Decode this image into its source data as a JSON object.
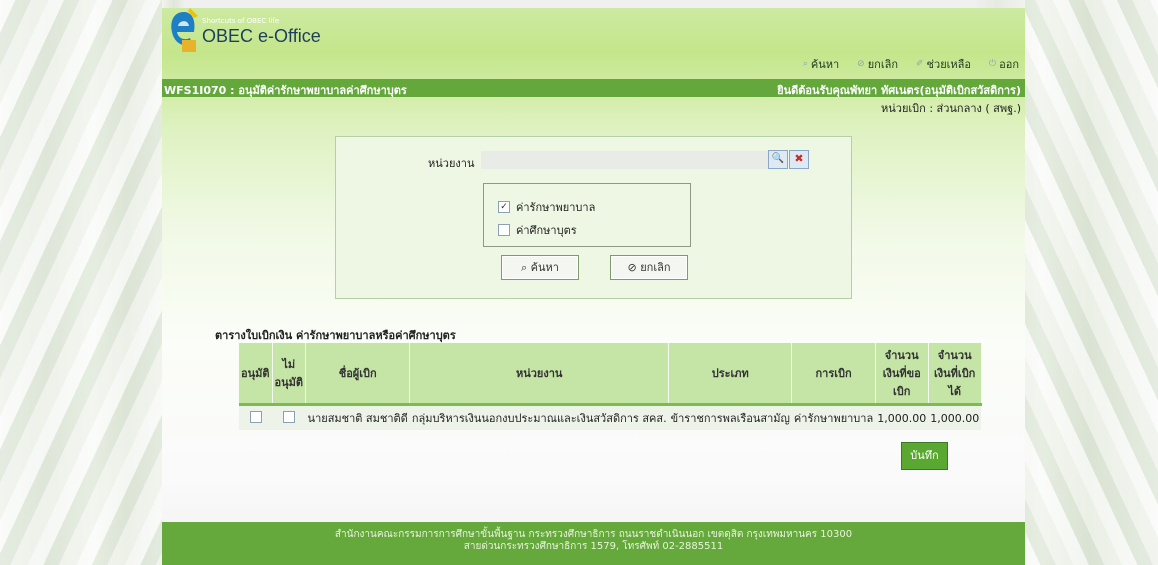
{
  "header": {
    "tagline": "Shortcuts of OBEC life",
    "app_title": "OBEC e-Office",
    "nav": [
      {
        "label": "ค้นหา",
        "icon": "search-icon"
      },
      {
        "label": "ยกเลิก",
        "icon": "cancel-icon"
      },
      {
        "label": "ช่วยเหลือ",
        "icon": "help-icon"
      },
      {
        "label": "ออก",
        "icon": "logout-icon"
      }
    ]
  },
  "titlebar": {
    "page_title": "WFS1I070 : อนุมัติค่ารักษาพยาบาลค่าศึกษาบุตร",
    "welcome": "ยินดีต้อนรับคุณพัทยา ทัศเนตร(อนุมัติเบิกสวัสดิการ)"
  },
  "unit_info": "หน่วยเบิก : ส่วนกลาง ( สพฐ.)",
  "search": {
    "unit_label": "หน่วยงาน",
    "unit_value": "",
    "options": [
      {
        "label": "ค่ารักษาพยาบาล",
        "checked": true
      },
      {
        "label": "ค่าศึกษาบุตร",
        "checked": false
      }
    ],
    "search_button": "ค้นหา",
    "cancel_button": "ยกเลิก"
  },
  "table": {
    "title": "ตารางใบเบิกเงิน ค่ารักษาพยาบาลหรือค่าศึกษาบุตร",
    "headers": [
      "อนุมัติ",
      "ไม่อนุมัติ",
      "ชื่อผู้เบิก",
      "หน่วยงาน",
      "ประเภท",
      "การเบิก",
      "จำนวนเงินที่ขอเบิก",
      "จำนวนเงินที่เบิกได้"
    ],
    "rows": [
      {
        "approve": false,
        "reject": false,
        "name": "นายสมชาติ สมชาติดี",
        "unit": "กลุ่มบริหารเงินนอกงบประมาณและเงินสวัสดิการ สคส.",
        "type": "ข้าราชการพลเรือนสามัญ",
        "claim": "ค่ารักษาพยาบาล",
        "requested": "1,000.00",
        "approved": "1,000.00"
      }
    ],
    "save_button": "บันทึก"
  },
  "footer": {
    "line1": "สำนักงานคณะกรรมการการศึกษาขั้นพื้นฐาน กระทรวงศึกษาธิการ ถนนราชดำเนินนอก เขตดุสิต กรุงเทพมหานคร 10300",
    "line2": "สายด่วนกระทรวงศึกษาธิการ 1579, โทรศัพท์ 02-2885511"
  }
}
